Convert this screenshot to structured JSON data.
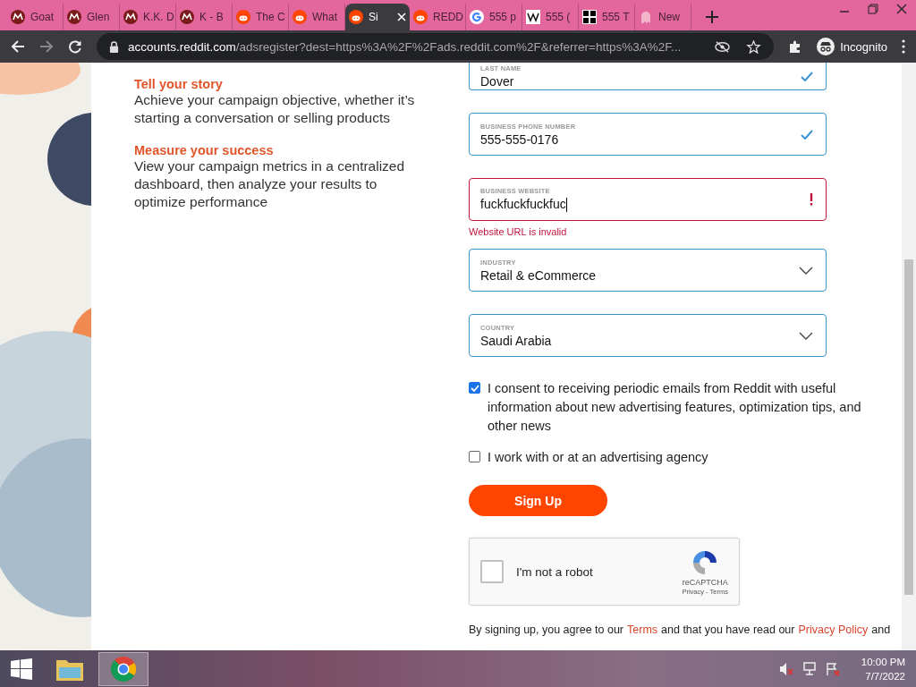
{
  "browser": {
    "tabs": [
      {
        "title": "Goat",
        "kind": "ma",
        "selected": false
      },
      {
        "title": "Glen",
        "kind": "ma",
        "selected": false
      },
      {
        "title": "K.K. D",
        "kind": "ma",
        "selected": false
      },
      {
        "title": "K - B",
        "kind": "ma",
        "selected": false
      },
      {
        "title": "The C",
        "kind": "reddit",
        "selected": false
      },
      {
        "title": "What",
        "kind": "reddit",
        "selected": false
      },
      {
        "title": "Si",
        "kind": "reddit",
        "selected": true
      },
      {
        "title": "REDD",
        "kind": "reddit",
        "selected": false
      },
      {
        "title": "555 p",
        "kind": "google",
        "selected": false
      },
      {
        "title": "555 (",
        "kind": "wiki",
        "selected": false
      },
      {
        "title": "555 T",
        "kind": "grid",
        "selected": false
      },
      {
        "title": "New",
        "kind": "ghost",
        "selected": false
      }
    ],
    "address": {
      "host": "accounts.reddit.com",
      "path": "/adsregister?dest=https%3A%2F%2Fads.reddit.com%2F&referrer=https%3A%2F..."
    },
    "profile": "Incognito"
  },
  "page": {
    "features": [
      {
        "heading": "Tell your story",
        "text": "Achieve your campaign objective, whether it’s starting a conversation or selling products"
      },
      {
        "heading": "Measure your success",
        "text": "View your campaign metrics in a centralized dashboard, then analyze your results to optimize performance"
      }
    ],
    "fields": [
      {
        "kind": "text",
        "label": "LAST NAME",
        "value": "Dover",
        "valid": true
      },
      {
        "kind": "text",
        "label": "BUSINESS PHONE NUMBER",
        "value": "555-555-0176",
        "valid": true
      },
      {
        "kind": "text",
        "label": "BUSINESS WEBSITE",
        "value": "fuckfuckfuckfuc",
        "valid": false,
        "error": "Website URL is invalid"
      },
      {
        "kind": "select",
        "label": "INDUSTRY",
        "value": "Retail & eCommerce"
      },
      {
        "kind": "select",
        "label": "COUNTRY",
        "value": "Saudi Arabia"
      }
    ],
    "consents": [
      {
        "text": "I consent to receiving periodic emails from Reddit with useful information about new advertising features, optimization tips, and other news",
        "checked": true
      },
      {
        "text": "I work with or at an advertising agency",
        "checked": false
      }
    ],
    "submit": "Sign Up",
    "recaptcha": {
      "label": "I'm not a robot",
      "checked": false,
      "brand": "reCAPTCHA",
      "links": "Privacy - Terms"
    },
    "legal": [
      {
        "kind": "text",
        "text": "By signing up, you agree to our"
      },
      {
        "kind": "link",
        "text": "Terms"
      },
      {
        "kind": "text",
        "text": "and that you have read our"
      },
      {
        "kind": "link",
        "text": "Privacy Policy"
      },
      {
        "kind": "text",
        "text": "and"
      }
    ]
  },
  "taskbar": {
    "time": "10:00 PM",
    "date": "7/7/2022"
  }
}
